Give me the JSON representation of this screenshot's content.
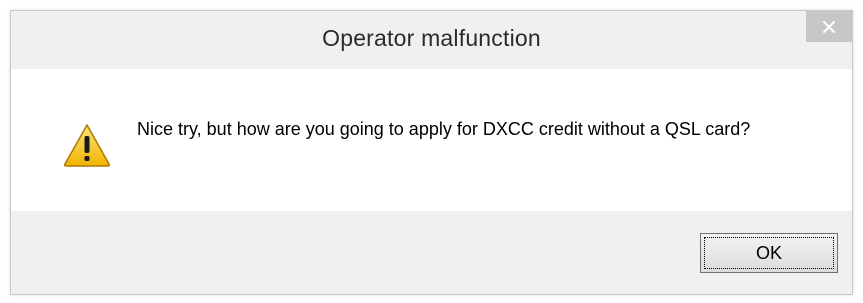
{
  "dialog": {
    "title": "Operator malfunction",
    "close_icon": "close-icon",
    "warning_icon": "warning-icon",
    "message": "Nice try, but how are you going to apply for DXCC credit without a QSL card?",
    "ok_label": "OK"
  },
  "colors": {
    "titlebar_bg": "#f0f0f0",
    "content_bg": "#ffffff",
    "close_button_bg": "#c7c7c7",
    "warning_yellow": "#f5c518",
    "warning_border": "#b07800"
  }
}
